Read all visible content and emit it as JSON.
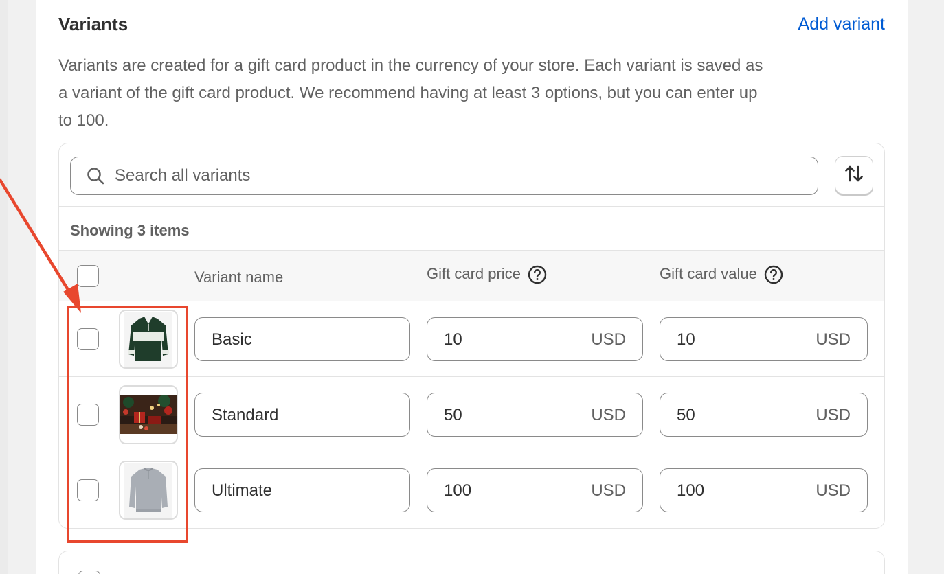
{
  "section": {
    "title": "Variants",
    "add_variant_label": "Add variant",
    "description": "Variants are created for a gift card product in the currency of your store. Each variant is saved as a variant of the gift card product. We recommend having at least 3 options, but you can enter up to 100."
  },
  "search": {
    "placeholder": "Search all variants"
  },
  "showing_label": "Showing 3 items",
  "columns": {
    "name": "Variant name",
    "price": "Gift card price",
    "value": "Gift card value"
  },
  "rows": [
    {
      "name": "Basic",
      "price": "10",
      "price_currency": "USD",
      "value": "10",
      "value_currency": "USD",
      "image": "green-white-polo-sweater"
    },
    {
      "name": "Standard",
      "price": "50",
      "price_currency": "USD",
      "value": "50",
      "value_currency": "USD",
      "image": "christmas-gifts-photo"
    },
    {
      "name": "Ultimate",
      "price": "100",
      "price_currency": "USD",
      "value": "100",
      "value_currency": "USD",
      "image": "gray-sweater"
    }
  ],
  "icons": {
    "search": "search-icon",
    "sort": "sort-arrows-icon",
    "help": "question-circle-icon"
  },
  "colors": {
    "accent_link": "#005bd3",
    "annotation": "#e8472e"
  }
}
